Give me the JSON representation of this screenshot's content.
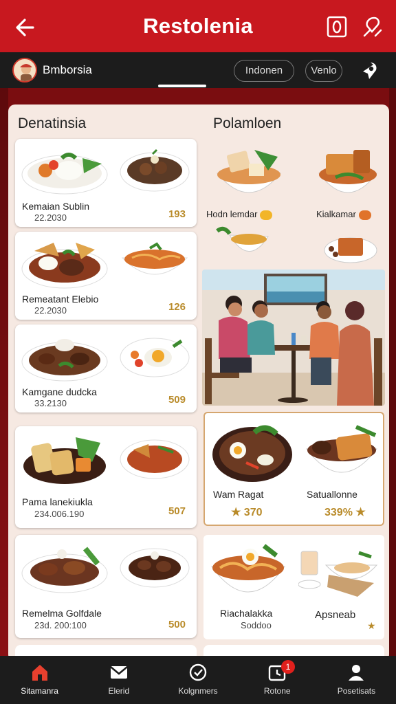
{
  "header": {
    "title": "Restolenia",
    "icons": [
      "back-arrow-icon",
      "square-icon",
      "map-pin-icon"
    ],
    "accent": "#c8181f"
  },
  "subbar": {
    "brand": "Bmborsia",
    "chips": [
      "Indonen",
      "Venlo"
    ],
    "icons": [
      "avatar",
      "location-icon"
    ]
  },
  "left": {
    "heading": "Denatinsia",
    "items": [
      {
        "name": "Kemaian Sublin",
        "sub": "22.2030",
        "price": "193"
      },
      {
        "name": "Remeatant Elebio",
        "sub": "22.2030",
        "price": "126"
      },
      {
        "name": "Kamgane dudcka",
        "sub": "33.2130",
        "price": "509"
      },
      {
        "name": "Pama lanekiukla",
        "sub": "234.006.190",
        "price": "507"
      },
      {
        "name": "Remelma Golfdale",
        "sub": "23d. 200:100",
        "price": "500"
      }
    ]
  },
  "right": {
    "heading": "Polamloen",
    "row1": [
      {
        "name": "Hodn lemdar"
      },
      {
        "name": "Kialkamar"
      }
    ],
    "featured": [
      {
        "name": "Wam Ragat",
        "price": "★ 370"
      },
      {
        "name": "Satuallonne",
        "price": "339% ★"
      }
    ],
    "bottom": [
      {
        "name": "Riachalakka",
        "sub": "Soddoo"
      },
      {
        "name": "Apsneab",
        "sub": "★"
      }
    ]
  },
  "nav": [
    {
      "label": "Sitamanra",
      "icon": "home-icon"
    },
    {
      "label": "Elerid",
      "icon": "mail-icon"
    },
    {
      "label": "Kolgnmers",
      "icon": "check-clock-icon"
    },
    {
      "label": "Rotone",
      "icon": "calendar-clock-icon",
      "badge": "1"
    },
    {
      "label": "Posetisats",
      "icon": "profile-icon"
    }
  ]
}
